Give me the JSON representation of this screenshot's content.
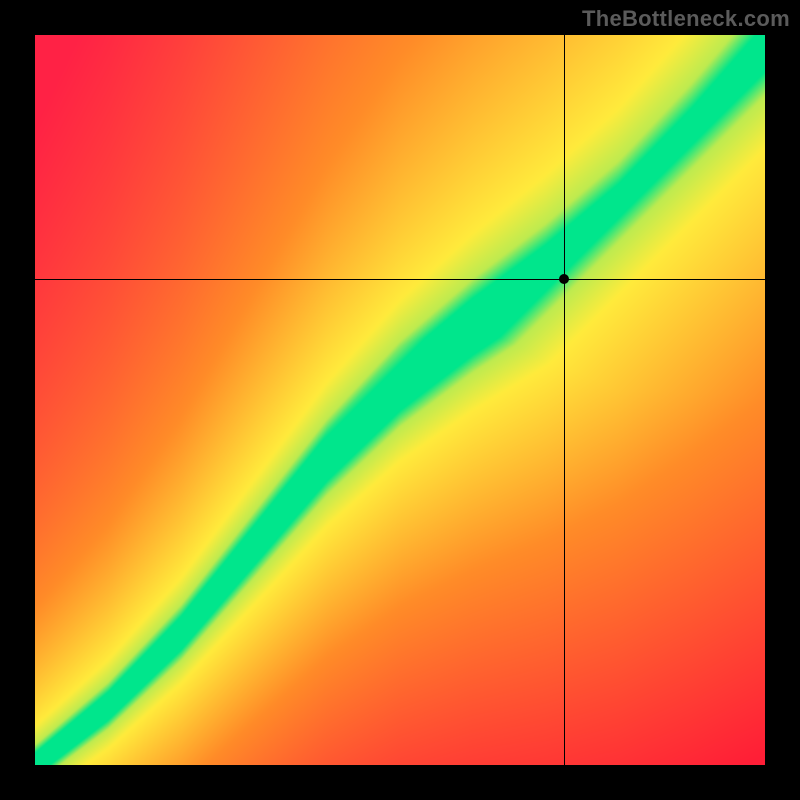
{
  "watermark": "TheBottleneck.com",
  "chart_data": {
    "type": "heatmap",
    "title": "",
    "xlabel": "",
    "ylabel": "",
    "xlim": [
      0,
      1
    ],
    "ylim": [
      0,
      1
    ],
    "crosshair": {
      "x": 0.725,
      "y": 0.665
    },
    "marker": {
      "x": 0.725,
      "y": 0.665
    },
    "colormap_note": "red→orange→yellow→green→yellow→orange→red along diagonal band",
    "band": {
      "description": "green optimal band along a curve from bottom-left to top-right; warm colors off-band",
      "curve_points": [
        {
          "x": 0.0,
          "y": 0.0
        },
        {
          "x": 0.1,
          "y": 0.08
        },
        {
          "x": 0.2,
          "y": 0.18
        },
        {
          "x": 0.3,
          "y": 0.3
        },
        {
          "x": 0.4,
          "y": 0.42
        },
        {
          "x": 0.5,
          "y": 0.52
        },
        {
          "x": 0.6,
          "y": 0.6
        },
        {
          "x": 0.7,
          "y": 0.67
        },
        {
          "x": 0.8,
          "y": 0.75
        },
        {
          "x": 0.9,
          "y": 0.85
        },
        {
          "x": 1.0,
          "y": 0.96
        }
      ],
      "green_halfwidth": 0.05,
      "yellow_halfwidth": 0.13
    }
  }
}
